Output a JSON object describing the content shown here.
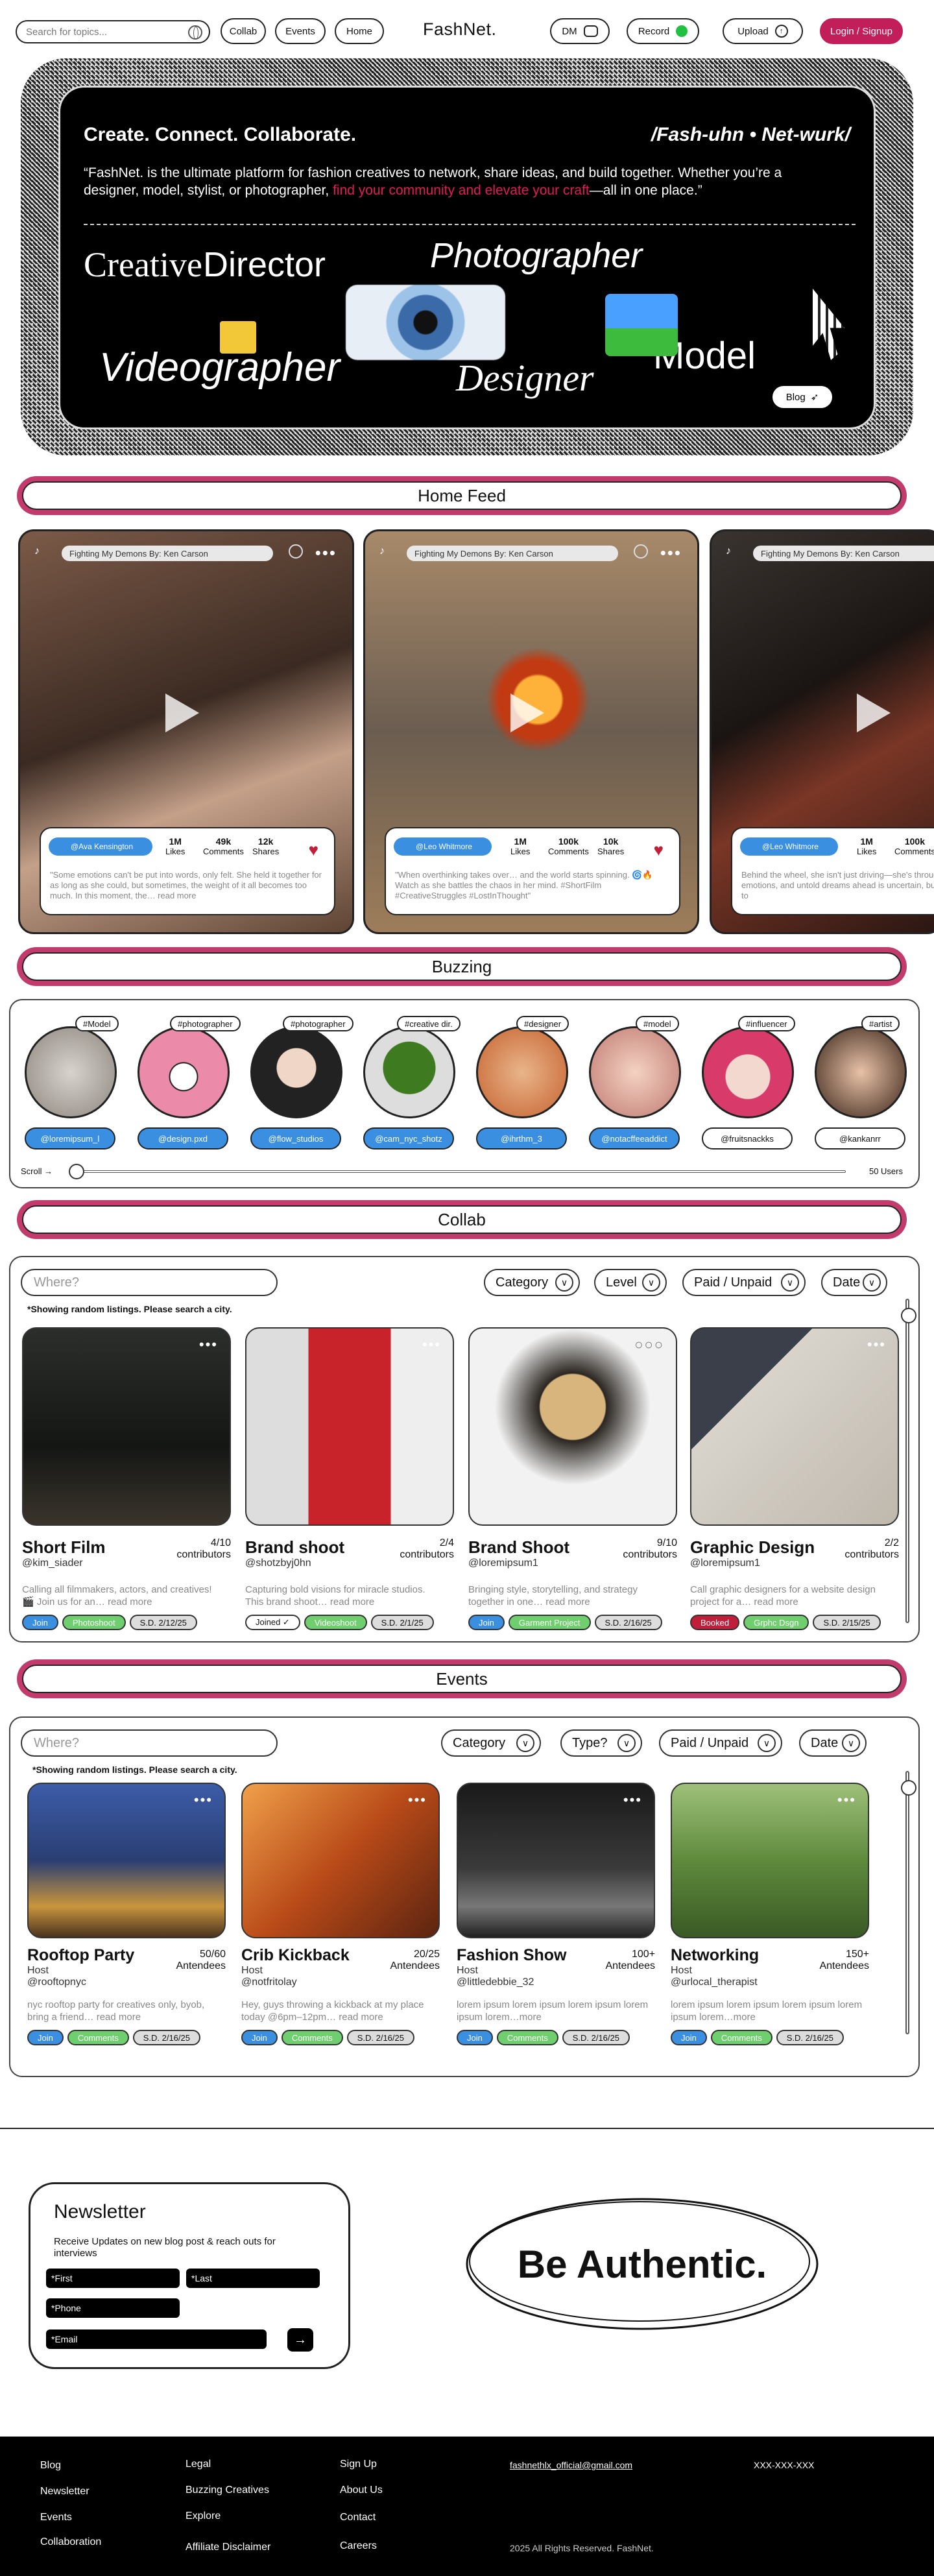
{
  "nav": {
    "search_placeholder": "Search for topics...",
    "collab": "Collab",
    "events": "Events",
    "home": "Home",
    "logo": "FashNet.",
    "dm": "DM",
    "record": "Record",
    "upload": "Upload",
    "login": "Login / Signup"
  },
  "hero": {
    "headline": "Create. Connect. Collaborate.",
    "pronunciation": "/Fash-uhn • Net-wurk/",
    "desc_a": "“FashNet. is the ultimate platform for fashion creatives to network, share ideas, and build together. Whether you’re a designer, model, stylist, or photographer, ",
    "desc_pink": "find your community and elevate your craft",
    "desc_b": "—all in one place.”",
    "role_creative": "Creative",
    "role_director": "Director",
    "role_photographer": "Photographer",
    "role_videographer": "Videographer",
    "role_designer": "Designer",
    "role_model": "Model",
    "blog": "Blog"
  },
  "sections": {
    "home_feed": "Home Feed",
    "buzzing": "Buzzing",
    "collab": "Collab",
    "events": "Events"
  },
  "feed": [
    {
      "song": "Fighting My Demons By: Ken Carson",
      "user": "@Ava Kensington",
      "likes": "1M",
      "comments": "49k",
      "shares": "12k",
      "likes_label": "Likes",
      "comments_label": "Comments",
      "shares_label": "Shares",
      "caption": "\"Some emotions can't be put into words, only felt. She held it together for as long as she could, but sometimes, the weight of it all becomes too much. In this moment, the… read more"
    },
    {
      "song": "Fighting My Demons By: Ken Carson",
      "user": "@Leo Whitmore",
      "likes": "1M",
      "comments": "100k",
      "shares": "10k",
      "likes_label": "Likes",
      "comments_label": "Comments",
      "shares_label": "Shares",
      "caption": "\"When overthinking takes over… and the world starts spinning. 🌀🔥 Watch as she battles the chaos in her mind. #ShortFilm #CreativeStruggles #LostInThought\""
    },
    {
      "song": "Fighting My Demons By: Ken Carson",
      "user": "@Leo Whitmore",
      "likes": "1M",
      "comments": "100k",
      "likes_label": "Likes",
      "comments_label": "Comments",
      "caption": "Behind the wheel, she isn't just driving—she's through memories, emotions, and untold dreams ahead is uncertain, but the moment is hers to"
    }
  ],
  "buzzing": {
    "users": [
      {
        "tag": "#Model",
        "handle": "@loremipsum_l"
      },
      {
        "tag": "#photographer",
        "handle": "@design.pxd"
      },
      {
        "tag": "#photographer",
        "handle": "@flow_studios"
      },
      {
        "tag": "#creative dir.",
        "handle": "@cam_nyc_shotz"
      },
      {
        "tag": "#designer",
        "handle": "@ihrthm_3"
      },
      {
        "tag": "#model",
        "handle": "@notacffeeaddict"
      },
      {
        "tag": "#influencer",
        "handle": "@fruitsnackks"
      },
      {
        "tag": "#artist",
        "handle": "@kankanrr"
      }
    ],
    "scroll_label": "Scroll →",
    "count": "50 Users"
  },
  "collab": {
    "where": "Where?",
    "filters": [
      "Category",
      "Level",
      "Paid / Unpaid",
      "Date"
    ],
    "note": "*Showing random listings. Please search a city.",
    "listings": [
      {
        "title": "Short Film",
        "host": "@kim_siader",
        "count": "4/10",
        "count_label": "contributors",
        "desc": "Calling all filmmakers, actors, and creatives! 🎬 Join us for an… read more",
        "t1": "Join",
        "t2": "Photoshoot",
        "t3": "S.D. 2/12/25"
      },
      {
        "title": "Brand shoot",
        "host": "@shotzbyj0hn",
        "count": "2/4",
        "count_label": "contributors",
        "desc": "Capturing bold visions for miracle studios. This brand shoot… read more",
        "t1": "Joined ✓",
        "t2": "Videoshoot",
        "t3": "S.D. 2/1/25"
      },
      {
        "title": "Brand Shoot",
        "host": "@loremipsum1",
        "count": "9/10",
        "count_label": "contributors",
        "desc": "Bringing style, storytelling, and strategy together in one… read more",
        "t1": "Join",
        "t2": "Garment Project",
        "t3": "S.D. 2/16/25"
      },
      {
        "title": "Graphic Design",
        "host": "@loremipsum1",
        "count": "2/2",
        "count_label": "contributors",
        "desc": "Call graphic designers for a website design project for a… read more",
        "t1": "Booked",
        "t2": "Grphc Dsgn",
        "t3": "S.D. 2/15/25"
      }
    ]
  },
  "events": {
    "where": "Where?",
    "filters": [
      "Category",
      "Type?",
      "Paid / Unpaid",
      "Date"
    ],
    "note": "*Showing random listings. Please search a city.",
    "listings": [
      {
        "title": "Rooftop Party",
        "role": "Host",
        "host": "@rooftopnyc",
        "count": "50/60",
        "count_label": "Antendees",
        "desc": "nyc rooftop party for creatives only, byob, bring a friend… read more",
        "t1": "Join",
        "t2": "Comments",
        "t3": "S.D. 2/16/25"
      },
      {
        "title": "Crib Kickback",
        "role": "Host",
        "host": "@notfritolay",
        "count": "20/25",
        "count_label": "Antendees",
        "desc": "Hey, guys throwing a kickback at my place today @6pm–12pm… read more",
        "t1": "Join",
        "t2": "Comments",
        "t3": "S.D. 2/16/25"
      },
      {
        "title": "Fashion Show",
        "role": "Host",
        "host": "@littledebbie_32",
        "count": "100+",
        "count_label": "Antendees",
        "desc": "lorem ipsum lorem ipsum lorem ipsum lorem ipsum lorem…more",
        "t1": "Join",
        "t2": "Comments",
        "t3": "S.D. 2/16/25"
      },
      {
        "title": "Networking",
        "role": "Host",
        "host": "@urlocal_therapist",
        "count": "150+",
        "count_label": "Antendees",
        "desc": "lorem ipsum lorem ipsum lorem ipsum lorem ipsum lorem…more",
        "t1": "Join",
        "t2": "Comments",
        "t3": "S.D. 2/16/25"
      }
    ]
  },
  "newsletter": {
    "title": "Newsletter",
    "desc": "Receive Updates on new blog post & reach outs for interviews",
    "first": "*First",
    "last": "*Last",
    "phone": "*Phone",
    "email": "*Email"
  },
  "authentic": "Be Authentic.",
  "footer": {
    "blog": "Blog",
    "newsletter": "Newsletter",
    "events": "Events",
    "collaboration": "Collaboration",
    "legal": "Legal",
    "buzzing": "Buzzing Creatives",
    "explore": "Explore",
    "affiliate": "Affiliate Disclaimer",
    "signup": "Sign Up",
    "about": "About Us",
    "contact": "Contact",
    "careers": "Careers",
    "email": "fashnethlx_official@gmail.com",
    "phone": "XXX-XXX-XXX",
    "copyright": "2025 All Rights Reserved. FashNet."
  }
}
